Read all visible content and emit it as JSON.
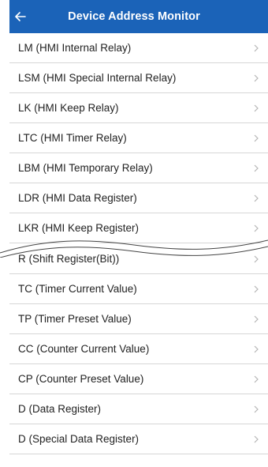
{
  "header": {
    "title": "Device Address Monitor",
    "back_icon": "back-arrow-icon",
    "background": "#1b63b8"
  },
  "list_top": [
    {
      "label": "LM (HMI Internal Relay)"
    },
    {
      "label": "LSM (HMI Special Internal Relay)"
    },
    {
      "label": "LK (HMI Keep Relay)"
    },
    {
      "label": "LTC (HMI Timer Relay)"
    },
    {
      "label": "LBM (HMI Temporary Relay)"
    },
    {
      "label": "LDR (HMI Data Register)"
    },
    {
      "label": "LKR (HMI Keep Register)"
    }
  ],
  "list_bottom": [
    {
      "label": "R (Shift Register(Bit))"
    },
    {
      "label": "TC (Timer Current Value)"
    },
    {
      "label": "TP (Timer Preset Value)"
    },
    {
      "label": "CC (Counter Current Value)"
    },
    {
      "label": "CP (Counter Preset Value)"
    },
    {
      "label": "D (Data Register)"
    },
    {
      "label": "D (Special Data Register)"
    }
  ]
}
